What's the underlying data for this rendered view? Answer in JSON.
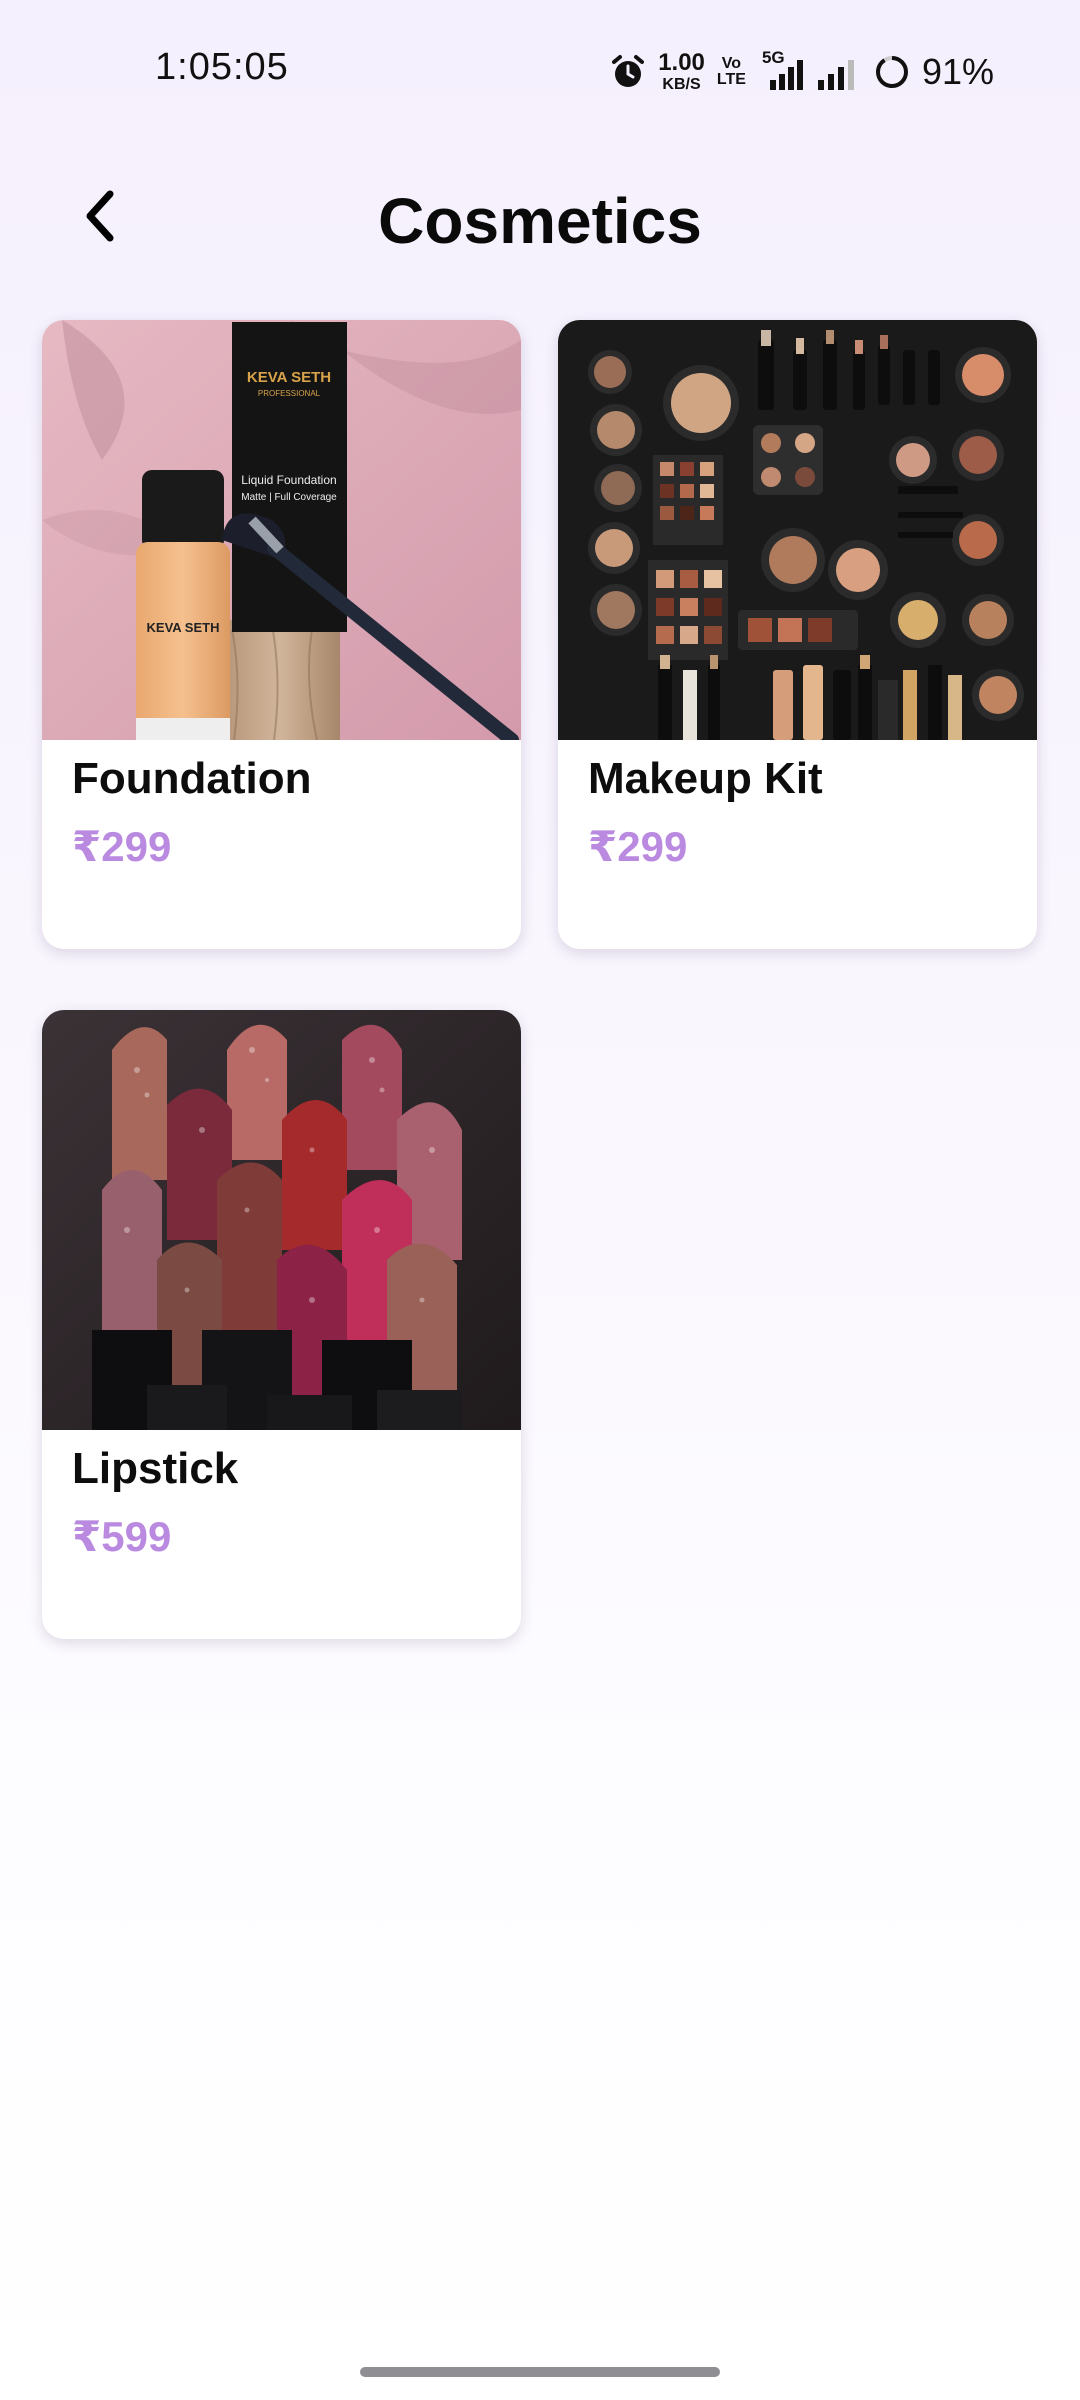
{
  "status_bar": {
    "time": "1:05:05",
    "net_speed_value": "1.00",
    "net_speed_unit": "KB/S",
    "volte_top": "Vo",
    "volte_bottom": "LTE",
    "network_type": "5G",
    "battery": "91%",
    "icons": [
      "alarm-icon",
      "volte-icon",
      "signal-5g-icon",
      "signal-icon",
      "battery-ring-icon"
    ]
  },
  "header": {
    "title": "Cosmetics",
    "back_icon": "chevron-left-icon"
  },
  "colors": {
    "price": "#b98ae0",
    "background_top": "#f5f0fd",
    "card": "#ffffff"
  },
  "products": [
    {
      "name": "Foundation",
      "price": "₹299",
      "image": {
        "brand": "KEVA SETH",
        "sub": "PROFESSIONAL",
        "line1": "Liquid Foundation",
        "line2": "Matte | Full Coverage"
      }
    },
    {
      "name": "Makeup Kit",
      "price": "₹299"
    },
    {
      "name": "Lipstick",
      "price": "₹599"
    }
  ]
}
